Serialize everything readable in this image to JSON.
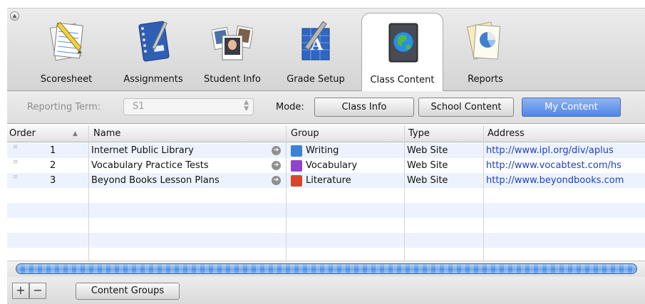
{
  "toolbar": {
    "tabs": [
      {
        "label": "Scoresheet",
        "icon": "scoresheet-icon",
        "selected": false
      },
      {
        "label": "Assignments",
        "icon": "notebook-icon",
        "selected": false
      },
      {
        "label": "Student Info",
        "icon": "student-photos-icon",
        "selected": false
      },
      {
        "label": "Grade Setup",
        "icon": "grade-setup-icon",
        "selected": false
      },
      {
        "label": "Class Content",
        "icon": "globe-book-icon",
        "selected": true
      },
      {
        "label": "Reports",
        "icon": "pie-chart-report-icon",
        "selected": false
      }
    ]
  },
  "options": {
    "reporting_term_label": "Reporting Term:",
    "reporting_term_value": "S1",
    "mode_label": "Mode:",
    "modes": [
      {
        "label": "Class Info",
        "active": false
      },
      {
        "label": "School Content",
        "active": false
      },
      {
        "label": "My Content",
        "active": true
      }
    ]
  },
  "table": {
    "columns": [
      "Order",
      "Name",
      "Group",
      "Type",
      "Address"
    ],
    "sort_indicator": "▲",
    "rows": [
      {
        "order": "1",
        "name": "Internet Public Library",
        "group": "Writing",
        "group_color": "#3b82d6",
        "type": "Web Site",
        "address": "http://www.ipl.org/div/aplus"
      },
      {
        "order": "2",
        "name": "Vocabulary Practice Tests",
        "group": "Vocabulary",
        "group_color": "#8e44c9",
        "type": "Web Site",
        "address": "http://www.vocabtest.com/hs"
      },
      {
        "order": "3",
        "name": "Beyond Books Lesson Plans",
        "group": "Literature",
        "group_color": "#d9452b",
        "type": "Web Site",
        "address": "http://www.beyondbooks.com"
      }
    ]
  },
  "bottom": {
    "add_label": "+",
    "remove_label": "−",
    "content_groups_label": "Content Groups"
  },
  "colors": {
    "accent": "#4f86e6",
    "link": "#1f3ec6",
    "row_stripe": "#edf3fe"
  }
}
